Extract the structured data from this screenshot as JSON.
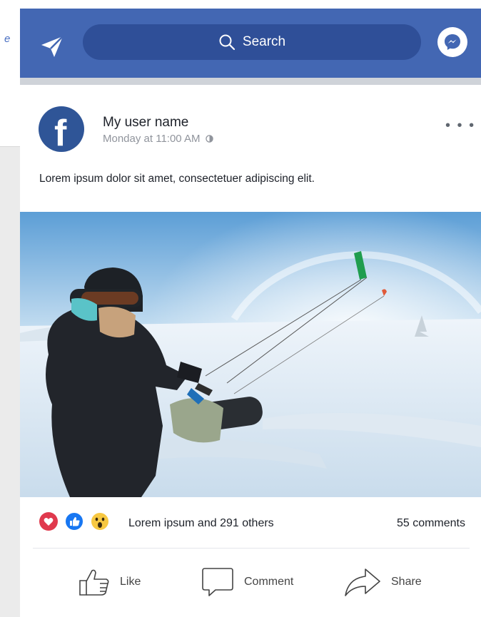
{
  "topbar": {
    "search_label": "Search"
  },
  "post": {
    "author": "My user name",
    "timestamp": "Monday at 11:00 AM",
    "text": "Lorem ipsum dolor sit amet, consectetuer adipiscing elit."
  },
  "engagement": {
    "reactions_text": "Lorem ipsum and  291 others",
    "comments_text": "55 comments"
  },
  "actions": {
    "like": "Like",
    "comment": "Comment",
    "share": "Share"
  },
  "colors": {
    "brand_blue": "#4367b3",
    "search_pill": "#2f4f98",
    "love": "#e0394d",
    "like": "#1877f2",
    "wow": "#f7c842"
  }
}
